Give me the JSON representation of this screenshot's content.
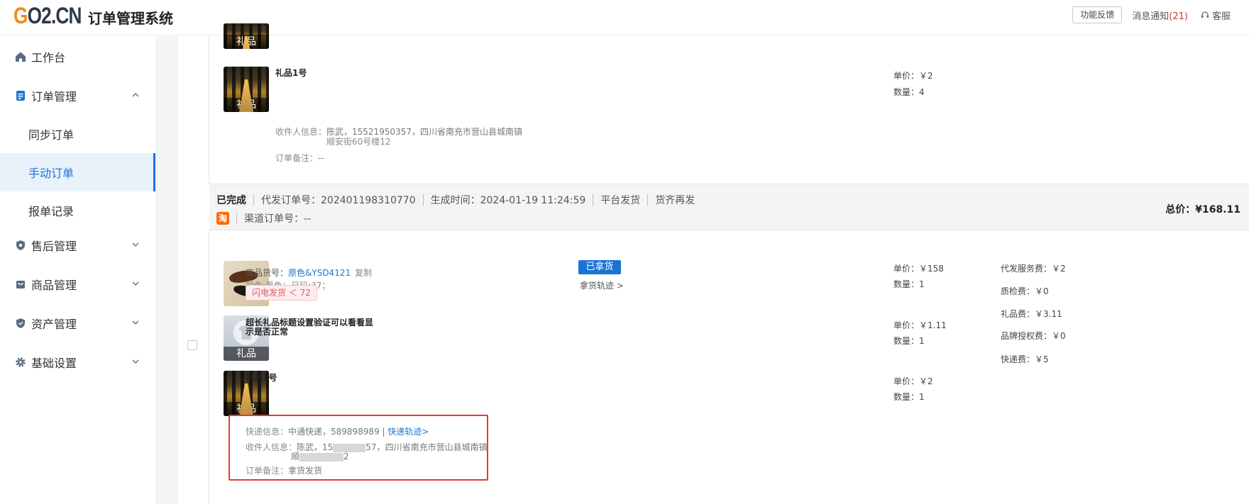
{
  "header": {
    "logo": "GO2.CN",
    "system_title": "订单管理系统",
    "feedback_label": "功能反馈",
    "notice_label": "消息通知",
    "notice_count": "(21)",
    "service_label": "客服"
  },
  "sidebar": {
    "items": [
      {
        "label": "工作台",
        "icon": "home-icon"
      },
      {
        "label": "订单管理",
        "icon": "document-icon"
      },
      {
        "label": "同步订单"
      },
      {
        "label": "手动订单"
      },
      {
        "label": "报单记录"
      },
      {
        "label": "售后管理",
        "icon": "shield-icon"
      },
      {
        "label": "商品管理",
        "icon": "bag-icon"
      },
      {
        "label": "资产管理",
        "icon": "shield-icon"
      },
      {
        "label": "基础设置",
        "icon": "gear-icon"
      }
    ]
  },
  "prev_order": {
    "top_thumb_label": "礼品",
    "product": {
      "name": "礼品1号",
      "thumb_label": "礼品",
      "unit_price": "单价：￥2",
      "quantity": "数量：4"
    },
    "receiver_label": "收件人信息：",
    "receiver_line1": "陈武，15521950357，四川省南充市营山县城南镇",
    "receiver_line2": "顺安街60号楼12",
    "remark_label": "订单备注：",
    "remark": "--"
  },
  "order": {
    "status": "已完成",
    "order_no": "代发订单号：202401198310770",
    "created": "生成时间：2024-01-19 11:24:59",
    "ship_mode": "平台发货",
    "reship": "货齐再发",
    "taobao_icon": "淘",
    "channel_no": "渠道订单号：--",
    "total_label": "总价：",
    "total_value": "¥168.11",
    "items": [
      {
        "sku_label": "商品货号：",
        "sku": "原色&YSD4121",
        "copy": "复制",
        "spec": "颜色:黑色；尺码:37；",
        "flash_tag": "闪电发货 ＜ 72",
        "pickup_status": "已拿货",
        "pickup_track": "拿货轨迹 >",
        "unit_price": "单价：￥158",
        "quantity": "数量：1"
      },
      {
        "name_line1": "超长礼品标题设置验证可以看看显",
        "name_line2": "示是否正常",
        "thumb_label": "礼品",
        "unit_price": "单价：￥1.11",
        "quantity": "数量：1"
      },
      {
        "name": "礼品1号",
        "thumb_label": "礼品",
        "unit_price": "单价：￥2",
        "quantity": "数量：1"
      }
    ],
    "fees": [
      "代发服务费：￥2",
      "质检费：￥0",
      "礼品费：￥3.11",
      "品牌授权费：￥0",
      "快递费：￥5"
    ],
    "express_label": "快递信息：",
    "express_value": "中通快递，589898989 | ",
    "express_link": "快递轨迹>",
    "receiver_label": "收件人信息：",
    "receiver_line1_a": "陈武，15",
    "receiver_line1_b": "57，四川省南充市营山县城南镇",
    "receiver_line2_a": "顺",
    "receiver_line2_b": "2",
    "remark_label": "订单备注：",
    "remark": "拿货发货"
  },
  "colors": {
    "accent": "#1a74d6",
    "highlight_box": "#e53935",
    "logo_orange": "#f28a18"
  }
}
